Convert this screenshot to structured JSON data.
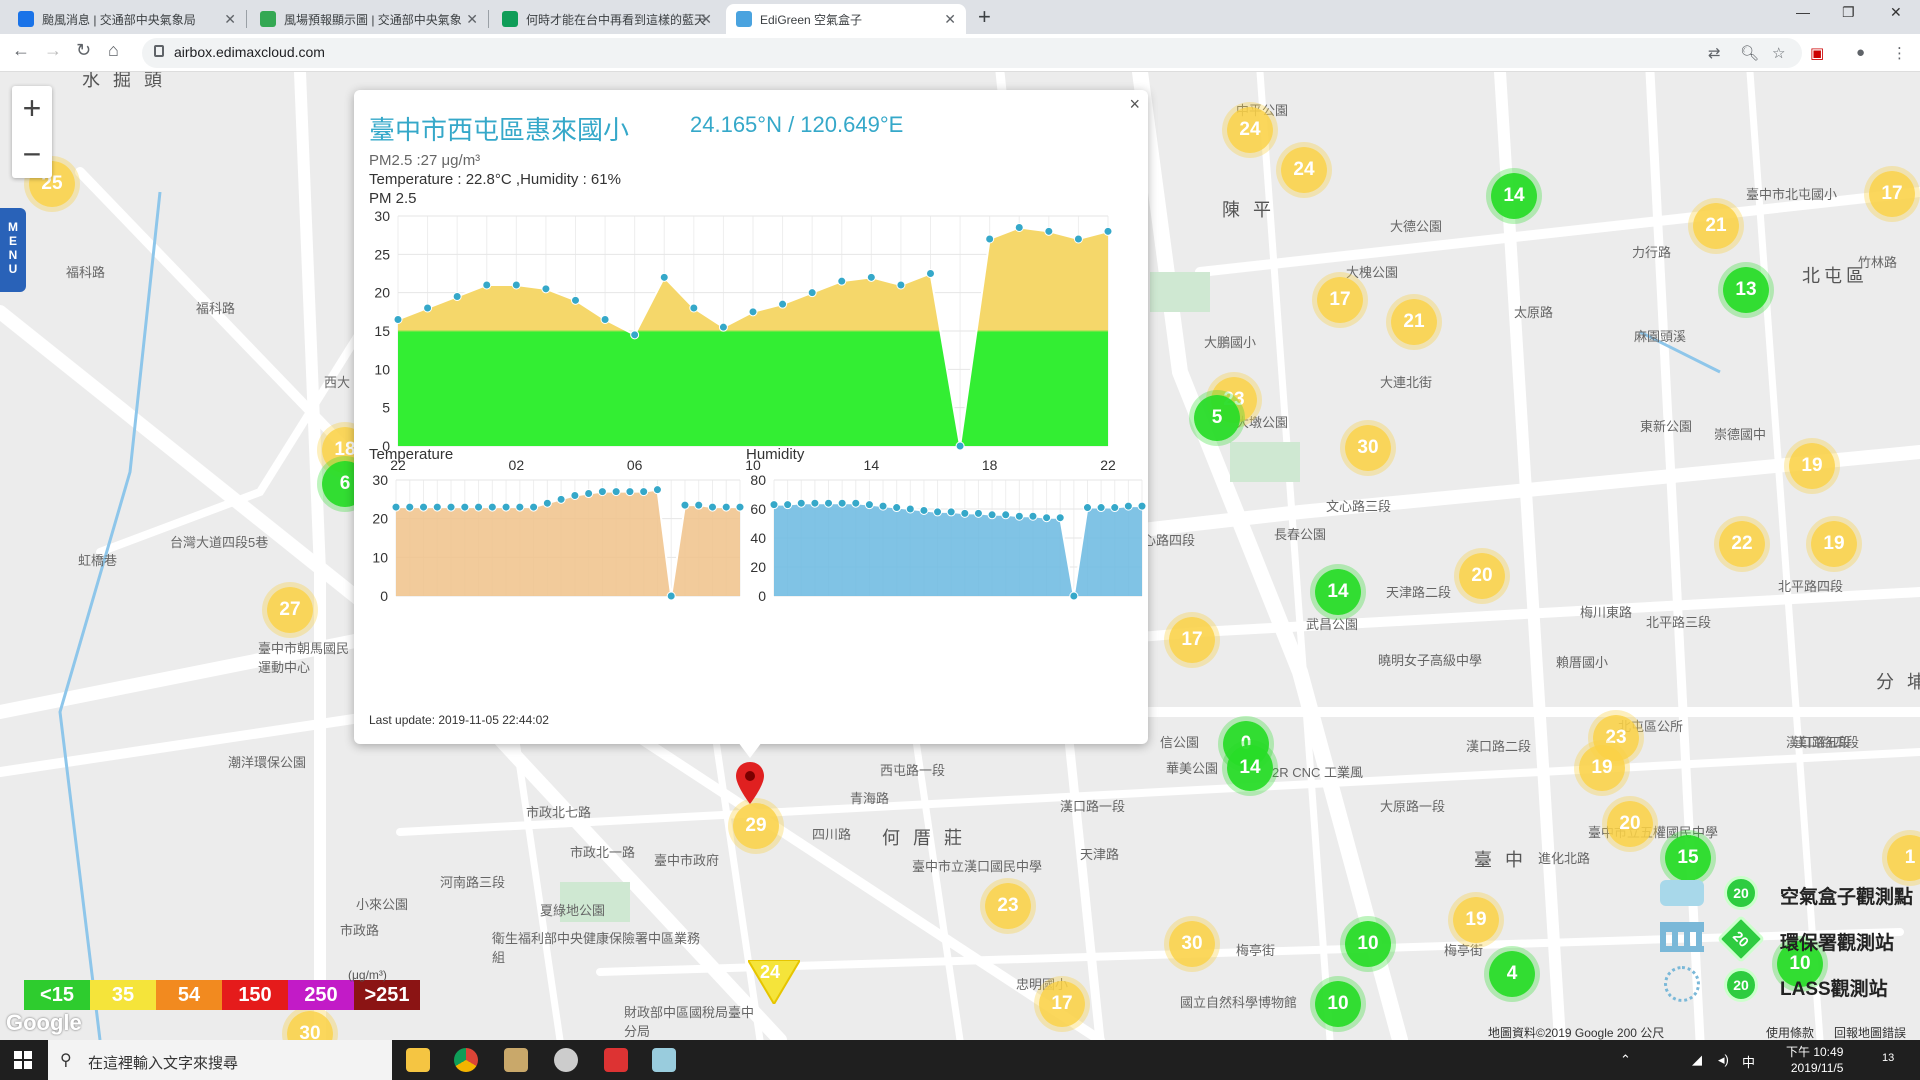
{
  "browser": {
    "tabs": [
      {
        "label": "颱風消息 | 交通部中央氣象局",
        "icon": "eye-icon",
        "color": "#1a73e8",
        "active": false
      },
      {
        "label": "風場預報顯示圖 | 交通部中央氣象",
        "icon": "map-icon",
        "color": "#34a853",
        "active": false
      },
      {
        "label": "何時才能在台中再看到這樣的藍天",
        "icon": "page-icon",
        "color": "#0f9d58",
        "active": false
      },
      {
        "label": "EdiGreen 空氣盒子",
        "icon": "edigreen-icon",
        "color": "#4aa3df",
        "active": true
      }
    ],
    "new_tab": "+",
    "url": "airbox.edimaxcloud.com",
    "window_controls": [
      "—",
      "❐",
      "✕"
    ]
  },
  "map": {
    "zoom_in": "+",
    "zoom_out": "−",
    "menu_label": "MENU",
    "place_labels": [
      "水 掘 頭",
      "福科路",
      "福科路",
      "西大",
      "台灣大道四段5巷",
      "虹橋巷",
      "臺中市朝馬國民運動中心",
      "潮洋環保公園",
      "市政北七路",
      "河南路三段",
      "市政北一路",
      "小來公園",
      "市政路",
      "夏綠地公園",
      "衛生福利部中央健康保險署中區業務組",
      "財政部中區國稅局臺中分局",
      "臺中市政府",
      "四川路",
      "何 厝 莊",
      "臺中市立漢口國民中學",
      "西屯路一段",
      "漢口路一段",
      "青海路",
      "天津路",
      "忠明國小",
      "國立自然科學博物館",
      "梅亭街",
      "中平公園",
      "陳 平",
      "大德公園",
      "大槐公園",
      "大鵬國小",
      "大墩公園",
      "長春公園",
      "文心路三段",
      "文心路四段",
      "武昌公園",
      "天津路二段",
      "曉明女子高級中學",
      "賴厝國小",
      "北屯區公所",
      "漢口路二段",
      "漢口路四段",
      "2R CNC 工業風",
      "華美公園",
      "信公園",
      "大原路一段",
      "梅亭街",
      "進化北路",
      "臺 中",
      "北平路三段",
      "北平路四段",
      "北屯區",
      "崇德國中",
      "東新公園",
      "麻園頭溪",
      "臺中市北屯國小",
      "竹林路",
      "力行路",
      "太原路",
      "大連北街",
      "臺中市立五權國民中學",
      "分 埔",
      "梅川東路",
      "漢口路五段"
    ],
    "markers": [
      {
        "value": "25",
        "color": "y"
      },
      {
        "value": "18",
        "color": "y"
      },
      {
        "value": "6",
        "color": "g"
      },
      {
        "value": "27",
        "color": "y"
      },
      {
        "value": "24",
        "color": "y"
      },
      {
        "value": "24",
        "color": "y"
      },
      {
        "value": "14",
        "color": "g"
      },
      {
        "value": "21",
        "color": "y"
      },
      {
        "value": "17",
        "color": "y"
      },
      {
        "value": "13",
        "color": "g"
      },
      {
        "value": "17",
        "color": "y"
      },
      {
        "value": "21",
        "color": "y"
      },
      {
        "value": "23",
        "color": "y"
      },
      {
        "value": "5",
        "color": "g"
      },
      {
        "value": "30",
        "color": "y"
      },
      {
        "value": "19",
        "color": "y"
      },
      {
        "value": "22",
        "color": "y"
      },
      {
        "value": "19",
        "color": "y"
      },
      {
        "value": "14",
        "color": "g"
      },
      {
        "value": "20",
        "color": "y"
      },
      {
        "value": "17",
        "color": "y"
      },
      {
        "value": "0",
        "color": "g"
      },
      {
        "value": "14",
        "color": "g"
      },
      {
        "value": "23",
        "color": "y"
      },
      {
        "value": "19",
        "color": "y"
      },
      {
        "value": "20",
        "color": "y"
      },
      {
        "value": "15",
        "color": "g"
      },
      {
        "value": "29",
        "color": "y"
      },
      {
        "value": "23",
        "color": "y"
      },
      {
        "value": "30",
        "color": "y"
      },
      {
        "value": "10",
        "color": "g"
      },
      {
        "value": "19",
        "color": "y"
      },
      {
        "value": "4",
        "color": "g"
      },
      {
        "value": "10",
        "color": "g"
      },
      {
        "value": "17",
        "color": "y"
      },
      {
        "value": "30",
        "color": "y"
      },
      {
        "value": "10",
        "color": "g"
      },
      {
        "value": "1",
        "color": "y"
      }
    ],
    "triangle_marker": "24",
    "scale": {
      "items": [
        {
          "label": "<15",
          "color": "#2ecc2e"
        },
        {
          "label": "35",
          "color": "#f5e43a"
        },
        {
          "label": "54",
          "color": "#f28a1f"
        },
        {
          "label": "150",
          "color": "#e51b1b"
        },
        {
          "label": "250",
          "color": "#c21bc7"
        },
        {
          "label": ">251",
          "color": "#8b1414"
        }
      ],
      "unit": "(μg/m³)"
    },
    "legend": [
      {
        "label": "空氣盒子觀測點",
        "badge": "20",
        "icon": "airbox-icon"
      },
      {
        "label": "環保署觀測站",
        "badge": "20",
        "icon": "government-building-icon"
      },
      {
        "label": "LASS觀測站",
        "badge": "20",
        "icon": "radar-icon"
      }
    ],
    "attribution": "地圖資料©2019 Google    200 公尺",
    "terms": "使用條款",
    "report": "回報地圖錯誤",
    "google_logo": "Google"
  },
  "popup": {
    "title": "臺中市西屯區惠來國小",
    "coords": "24.165°N / 120.649°E",
    "pm25": "PM2.5 :27 μg/m³",
    "temp_hum": "Temperature : 22.8°C ,Humidity : 61%",
    "chart_label": "PM 2.5",
    "temp_label": "Temperature",
    "hum_label": "Humidity",
    "last_update": "Last update: 2019-11-05 22:44:02",
    "close": "×"
  },
  "chart_data": [
    {
      "type": "area",
      "title": "PM 2.5",
      "x": [
        "22",
        "23",
        "00",
        "01",
        "02",
        "03",
        "04",
        "05",
        "06",
        "07",
        "08",
        "09",
        "10",
        "11",
        "12",
        "13",
        "14",
        "15",
        "16",
        "17",
        "18",
        "19",
        "20",
        "21",
        "22"
      ],
      "x_ticks": [
        "22",
        "02",
        "06",
        "10",
        "14",
        "18",
        "22"
      ],
      "values": [
        16.5,
        18,
        19.5,
        21,
        21,
        20.5,
        19,
        16.5,
        14.5,
        22,
        18,
        15.5,
        17.5,
        18.5,
        20,
        21.5,
        22,
        21,
        22.5,
        0,
        27,
        28.5,
        28,
        27,
        28
      ],
      "ylim": [
        0,
        30
      ],
      "y_ticks": [
        0,
        5,
        10,
        15,
        20,
        25,
        30
      ],
      "threshold": 15,
      "colors": {
        "below": "#33ee33",
        "above": "#f5d76a"
      }
    },
    {
      "type": "area",
      "title": "Temperature",
      "values": [
        23,
        23,
        23,
        23,
        23,
        23,
        23,
        23,
        23,
        23,
        23,
        24,
        25,
        26,
        26.5,
        27,
        27,
        27,
        27,
        27.5,
        0,
        23.5,
        23.5,
        23,
        23,
        23
      ],
      "ylim": [
        0,
        30
      ],
      "y_ticks": [
        0,
        10,
        20,
        30
      ],
      "color": "#f0c28a"
    },
    {
      "type": "area",
      "title": "Humidity",
      "values": [
        63,
        63,
        64,
        64,
        64,
        64,
        64,
        63,
        62,
        61,
        60,
        59,
        58,
        58,
        57,
        57,
        56,
        56,
        55,
        55,
        54,
        54,
        0,
        61,
        61,
        61,
        62,
        62
      ],
      "ylim": [
        0,
        80
      ],
      "y_ticks": [
        0,
        20,
        40,
        60,
        80
      ],
      "color": "#6ab8e0"
    }
  ],
  "taskbar": {
    "search_placeholder": "在這裡輸入文字來搜尋",
    "time": "下午 10:49",
    "date": "2019/11/5",
    "ime": "中",
    "notifications": "13"
  }
}
